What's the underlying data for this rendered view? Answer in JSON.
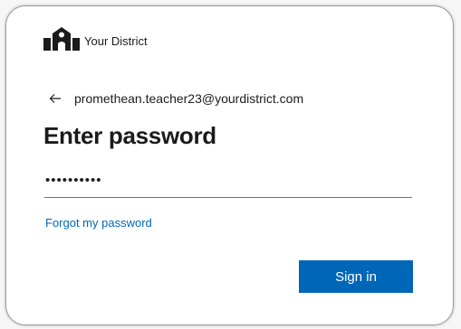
{
  "brand": {
    "name": "Your District",
    "logo_icon": "school-building-icon"
  },
  "identity": {
    "back_icon": "back-arrow-icon",
    "email": "promethean.teacher23@yourdistrict.com"
  },
  "title": "Enter password",
  "password_field": {
    "value": "••••••••••",
    "type": "password"
  },
  "forgot_password_link": "Forgot my password",
  "sign_in_button": "Sign in",
  "colors": {
    "accent": "#0067b8",
    "text": "#1b1b1b",
    "button_text": "#ffffff"
  }
}
